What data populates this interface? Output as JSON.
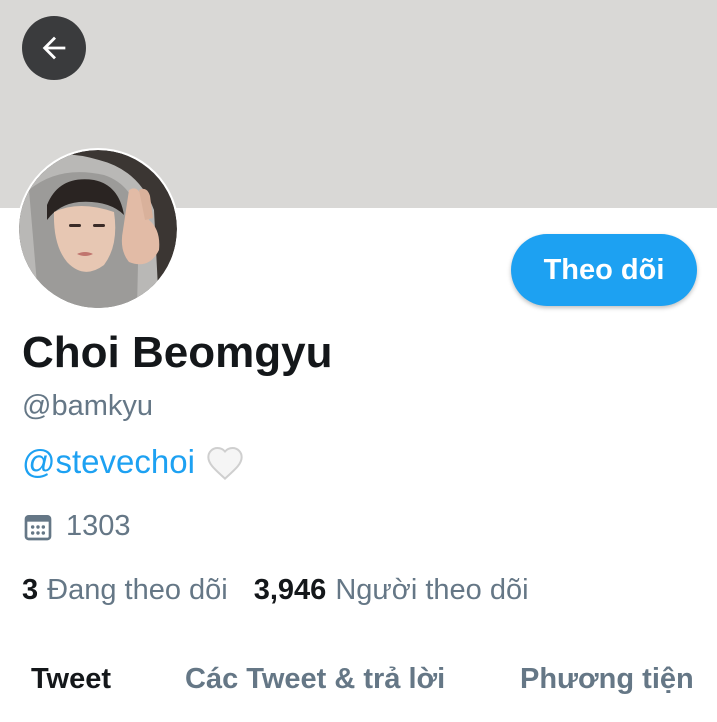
{
  "profile": {
    "name": "Choi Beomgyu",
    "handle": "@bamkyu",
    "bio_link": "@stevechoi",
    "bio_emoji": "🤍",
    "joined": "1303"
  },
  "actions": {
    "follow_label": "Theo dõi"
  },
  "stats": {
    "following_count": "3",
    "following_label": "Đang theo dõi",
    "followers_count": "3,946",
    "followers_label": "Người theo dõi"
  },
  "tabs": [
    {
      "label": "Tweet",
      "active": true
    },
    {
      "label": "Các Tweet & trả lời",
      "active": false
    },
    {
      "label": "Phương tiện",
      "active": false
    }
  ],
  "colors": {
    "accent": "#1da1f2",
    "text_primary": "#14171a",
    "text_secondary": "#657786",
    "banner": "#d9d8d6"
  },
  "icons": {
    "back": "arrow-left-icon",
    "joined": "calendar-icon"
  }
}
